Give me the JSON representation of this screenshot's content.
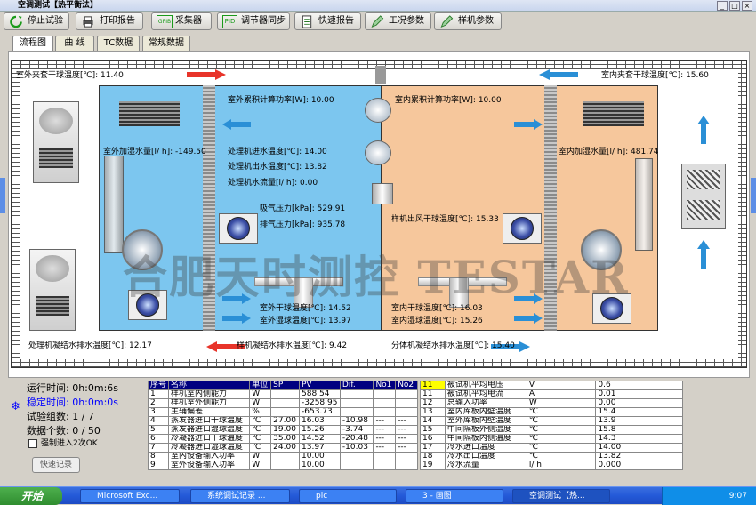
{
  "window": {
    "title": "空调测试【热平衡法】"
  },
  "toolbar": {
    "buttons": [
      {
        "label": "停止试验",
        "icon": "refresh-icon"
      },
      {
        "label": "打印报告",
        "icon": "printer-icon"
      },
      {
        "label": "采集器",
        "icon": "gpib-icon",
        "icon_text": "GPIB"
      },
      {
        "label": "调节器同步",
        "icon": "pid-icon",
        "icon_text": "PID"
      },
      {
        "label": "快速报告",
        "icon": "document-icon"
      },
      {
        "label": "工况参数",
        "icon": "pencil-icon"
      },
      {
        "label": "样机参数",
        "icon": "pencil-icon"
      }
    ]
  },
  "tabs": [
    {
      "label": "流程图",
      "active": true
    },
    {
      "label": "曲  线"
    },
    {
      "label": "TC数据"
    },
    {
      "label": "常规数据"
    }
  ],
  "diagram": {
    "outdoor_wall_dry": "室外夹套干球温度[℃]: 11.40",
    "indoor_wall_dry": "室内夹套干球温度[℃]: 15.60",
    "outdoor_cum_power": "室外累积计算功率[W]: 10.00",
    "indoor_cum_power": "室内累积计算功率[W]: 10.00",
    "outdoor_humidify": "室外加湿水量[l/ h]: -149.50",
    "indoor_humidify": "室内加湿水量[l/ h]: 481.74",
    "proc_in_temp": "处理机进水温度[℃]: 14.00",
    "proc_out_temp": "处理机出水温度[℃]: 13.82",
    "proc_flow": "处理机水流量[l/ h]: 0.00",
    "suction_pressure": "吸气压力[kPa]: 529.91",
    "discharge_pressure": "排气压力[kPa]: 935.78",
    "sample_out_dry": "样机出风干球温度[℃]: 15.33",
    "outdoor_dry": "室外干球温度[℃]: 14.52",
    "outdoor_wet": "室外湿球温度[℃]: 13.97",
    "indoor_dry": "室内干球温度[℃]: 16.03",
    "indoor_wet": "室内湿球温度[℃]: 15.26",
    "proc_condensate": "处理机凝结水排水温度[℃]: 12.17",
    "sample_condensate": "样机凝结水排水温度[℃]: 9.42",
    "split_condensate": "分体机凝结水排水温度[℃]: 15.40",
    "watermark": "合肥天时测控 TESTAR"
  },
  "status": {
    "run_time": "运行时间: 0h:0m:6s",
    "stable_time": "稳定时间: 0h:0m:0s",
    "group_count": "试验组数: 1 / 7",
    "data_count": "数据个数: 0 / 50",
    "force_label": "强制进入2次OK",
    "quick_record": "快速记录",
    "colors": {
      "stable": "#0000ff",
      "accent": "#000080"
    }
  },
  "table_left": {
    "headers": [
      "序号",
      "名称",
      "单位",
      "SP",
      "PV",
      "Dif.",
      "No1",
      "No2"
    ],
    "rows": [
      [
        "1",
        "样机室内侧能力",
        "W",
        "",
        "588.54",
        "",
        "",
        ""
      ],
      [
        "2",
        "样机室外侧能力",
        "W",
        "",
        "-3258.95",
        "",
        "",
        ""
      ],
      [
        "3",
        "主辅偏差",
        "%",
        "",
        "-653.73",
        "",
        "",
        ""
      ],
      [
        "4",
        "蒸发器进口干球温度",
        "℃",
        "27.00",
        "16.03",
        "-10.98",
        "---",
        "---"
      ],
      [
        "5",
        "蒸发器进口湿球温度",
        "℃",
        "19.00",
        "15.26",
        "-3.74",
        "---",
        "---"
      ],
      [
        "6",
        "冷凝器进口干球温度",
        "℃",
        "35.00",
        "14.52",
        "-20.48",
        "---",
        "---"
      ],
      [
        "7",
        "冷凝器进口湿球温度",
        "℃",
        "24.00",
        "13.97",
        "-10.03",
        "---",
        "---"
      ],
      [
        "8",
        "室内设备输入功率",
        "W",
        "",
        "10.00",
        "",
        "",
        ""
      ],
      [
        "9",
        "室外设备输入功率",
        "W",
        "",
        "10.00",
        "",
        "",
        ""
      ]
    ]
  },
  "table_right": {
    "rows": [
      [
        "11",
        "被试机平均电压",
        "V",
        "0.6"
      ],
      [
        "11",
        "被试机平均电流",
        "A",
        "0.01"
      ],
      [
        "12",
        "总输入功率",
        "W",
        "0.00"
      ],
      [
        "13",
        "室内库板内壁温度",
        "℃",
        "15.4"
      ],
      [
        "14",
        "室外库板内壁温度",
        "℃",
        "13.9"
      ],
      [
        "15",
        "中间隔板外侧温度",
        "℃",
        "15.8"
      ],
      [
        "16",
        "中间隔板内侧温度",
        "℃",
        "14.3"
      ],
      [
        "17",
        "冷水进口温度",
        "℃",
        "14.00"
      ],
      [
        "18",
        "冷水出口温度",
        "℃",
        "13.82"
      ],
      [
        "19",
        "冷水流量",
        "l/ h",
        "0.000"
      ]
    ]
  },
  "taskbar": {
    "start": "开始",
    "tasks": [
      "Microsoft Exc...",
      "系统调试记录 ...",
      "pic",
      "3 - 画图",
      "空调测试【热..."
    ],
    "clock": "9:07"
  }
}
